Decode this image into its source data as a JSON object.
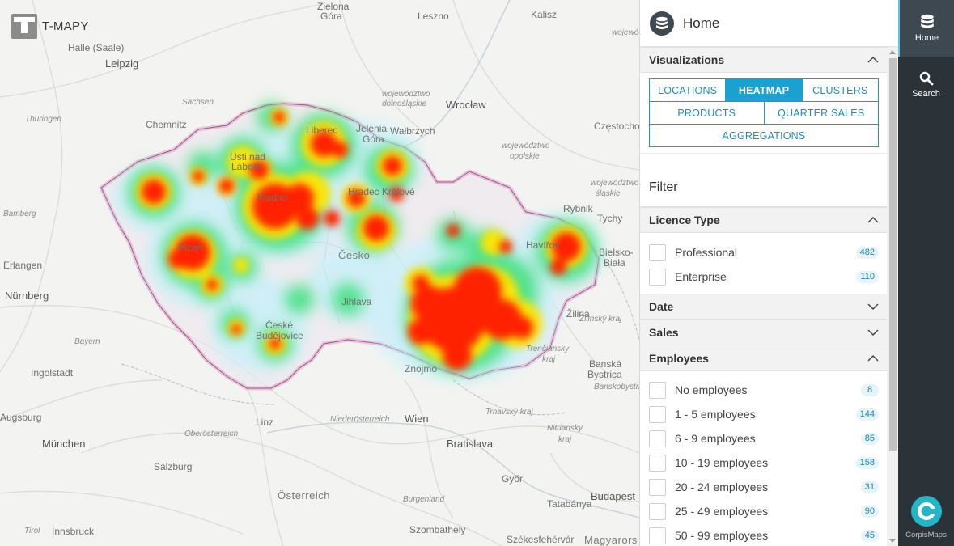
{
  "app": {
    "logo_text": "T-MAPY"
  },
  "map": {
    "cities": [
      {
        "name": "Zielona",
        "cls": "city"
      },
      {
        "name": "Góra",
        "cls": "city"
      },
      {
        "name": "Leszno",
        "cls": "city"
      },
      {
        "name": "Kalisz",
        "cls": "city"
      },
      {
        "name": "Halle (Saale)",
        "cls": "city"
      },
      {
        "name": "Leipzig",
        "cls": "city-lg"
      },
      {
        "name": "Wrocław",
        "cls": "city-lg"
      },
      {
        "name": "Chemnitz",
        "cls": "city"
      },
      {
        "name": "Liberec",
        "cls": "city"
      },
      {
        "name": "Jelenia",
        "cls": "city"
      },
      {
        "name": "Góra",
        "cls": "city"
      },
      {
        "name": "Wałbrzych",
        "cls": "city"
      },
      {
        "name": "Częstochowa",
        "cls": "city"
      },
      {
        "name": "Rybnik",
        "cls": "city"
      },
      {
        "name": "Tychy",
        "cls": "city"
      },
      {
        "name": "Bielsko-",
        "cls": "city"
      },
      {
        "name": "Biała",
        "cls": "city"
      },
      {
        "name": "Erlangen",
        "cls": "city"
      },
      {
        "name": "Nürnberg",
        "cls": "city-lg"
      },
      {
        "name": "Česko",
        "cls": "country"
      },
      {
        "name": "Jihlava",
        "cls": "city"
      },
      {
        "name": "České",
        "cls": "city"
      },
      {
        "name": "Budějovice",
        "cls": "city"
      },
      {
        "name": "Žilina",
        "cls": "city"
      },
      {
        "name": "Ingolstadt",
        "cls": "city"
      },
      {
        "name": "Banská",
        "cls": "city"
      },
      {
        "name": "Bystrica",
        "cls": "city"
      },
      {
        "name": "Linz",
        "cls": "city"
      },
      {
        "name": "Wien",
        "cls": "city-lg"
      },
      {
        "name": "Bratislava",
        "cls": "city-lg"
      },
      {
        "name": "München",
        "cls": "city-lg"
      },
      {
        "name": "Salzburg",
        "cls": "city"
      },
      {
        "name": "Győr",
        "cls": "city"
      },
      {
        "name": "Österreich",
        "cls": "country"
      },
      {
        "name": "Budapest",
        "cls": "city-lg"
      },
      {
        "name": "Tatabánya",
        "cls": "city"
      },
      {
        "name": "Innsbruck",
        "cls": "city"
      },
      {
        "name": "Szombathely",
        "cls": "city"
      },
      {
        "name": "Székesfehérvár",
        "cls": "city"
      },
      {
        "name": "Magyarors",
        "cls": "country"
      },
      {
        "name": "Augsburg",
        "cls": "city"
      },
      {
        "name": "Usti nad",
        "cls": "city"
      },
      {
        "name": "Labem",
        "cls": "city"
      },
      {
        "name": "Plzeň",
        "cls": "city"
      },
      {
        "name": "Kladno",
        "cls": "city"
      },
      {
        "name": "Znojmo",
        "cls": "city"
      },
      {
        "name": "Hradec Králové",
        "cls": "city"
      },
      {
        "name": "Havířov",
        "cls": "city"
      }
    ],
    "regions": [
      "Sachsen",
      "Thüringen",
      "województwo",
      "dolnośląskie",
      "województwo",
      "opolskie",
      "województwo",
      "śląskie",
      "Bayern",
      "Oberösterreich",
      "Niederösterreich",
      "Trnavský kraj",
      "Nitriansky",
      "kraj",
      "Burgenland",
      "Trenčiansky",
      "kraj",
      "Žilinský kraj",
      "Tirol",
      "wojewódz",
      "Bamberg",
      "Banskobystrický"
    ]
  },
  "panel": {
    "header_title": "Home",
    "visualizations": {
      "title": "Visualizations",
      "row1": [
        "LOCATIONS",
        "HEATMAP",
        "CLUSTERS"
      ],
      "row2": [
        "PRODUCTS",
        "QUARTER SALES"
      ],
      "row3": [
        "AGGREGATIONS"
      ],
      "active": "HEATMAP"
    },
    "filter_title": "Filter",
    "licence": {
      "title": "Licence Type",
      "options": [
        {
          "label": "Professional",
          "count": "482"
        },
        {
          "label": "Enterprise",
          "count": "110"
        }
      ]
    },
    "date_title": "Date",
    "sales_title": "Sales",
    "employees": {
      "title": "Employees",
      "options": [
        {
          "label": "No employees",
          "count": "8"
        },
        {
          "label": "1 - 5 employees",
          "count": "144"
        },
        {
          "label": "6 - 9 employees",
          "count": "85"
        },
        {
          "label": "10 - 19 employees",
          "count": "158"
        },
        {
          "label": "20 - 24 employees",
          "count": "31"
        },
        {
          "label": "25 - 49 employees",
          "count": "90"
        },
        {
          "label": "50 - 99 employees",
          "count": "45"
        }
      ]
    }
  },
  "nav": {
    "home_label": "Home",
    "search_label": "Search",
    "brand_label": "CorpisMaps"
  },
  "colors": {
    "accent": "#1aa1cf",
    "nav_bg": "#2b3238",
    "heat_hot": "#ff2200",
    "heat_warm": "#ffee00",
    "heat_cool": "#33dd77"
  }
}
